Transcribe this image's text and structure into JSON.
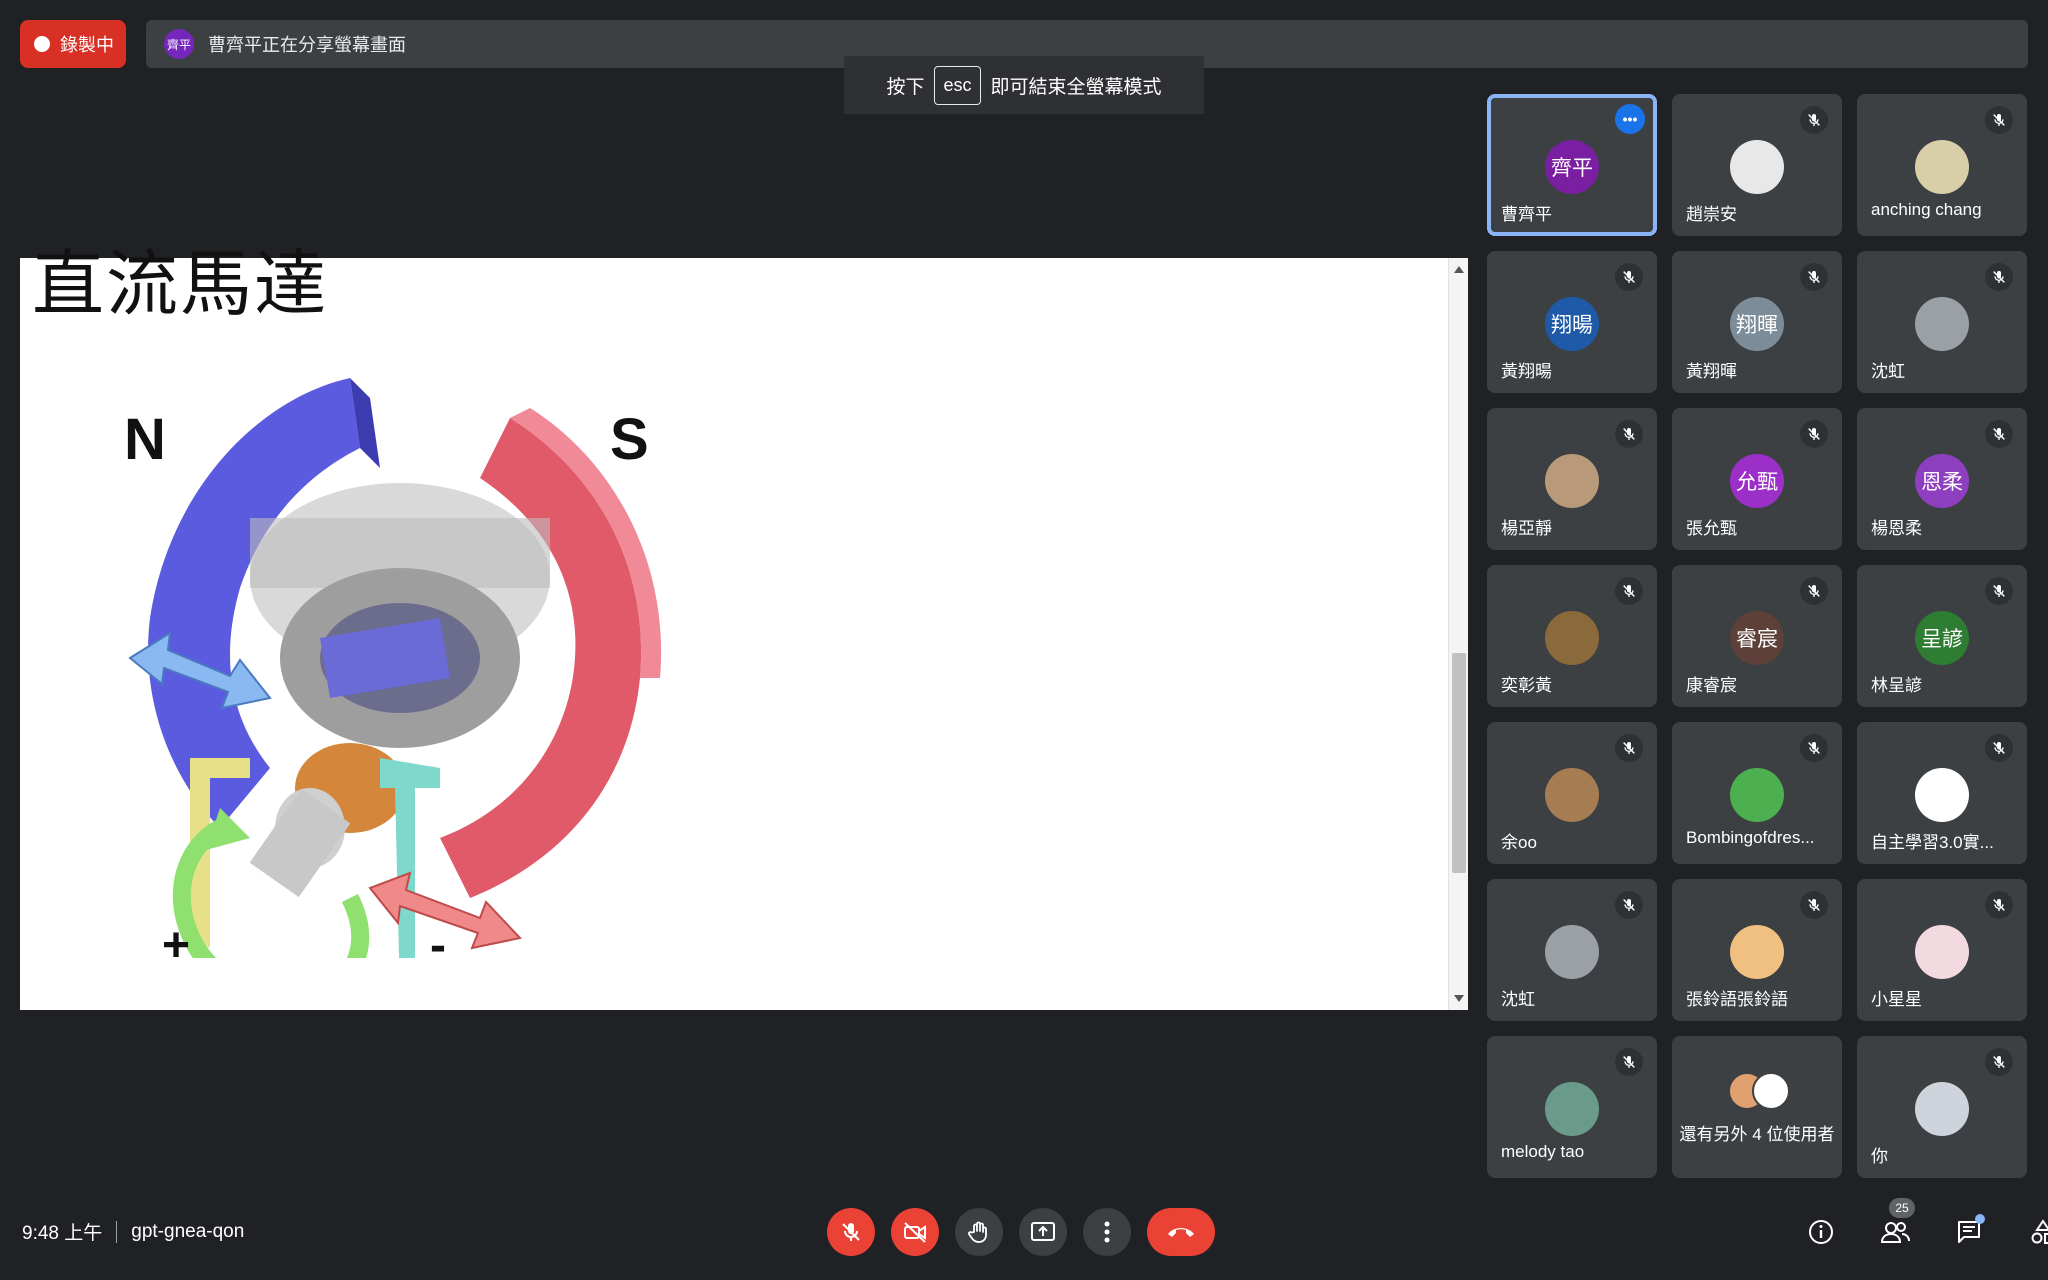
{
  "recording": {
    "label": "錄製中"
  },
  "share_banner": {
    "avatar_text": "齊平",
    "text": "曹齊平正在分享螢幕畫面"
  },
  "esc_hint": {
    "prefix": "按下",
    "key": "esc",
    "suffix": "即可結束全螢幕模式"
  },
  "slide": {
    "title": "直流馬達",
    "pole_n": "N",
    "pole_s": "S",
    "terminal_plus": "+",
    "terminal_minus": "-"
  },
  "participants": [
    {
      "name": "曹齊平",
      "avatar_text": "齊平",
      "avatar_color": "#7b1fa2",
      "active": true
    },
    {
      "name": "趙崇安",
      "avatar_text": "",
      "avatar_color": "#e8e8e8"
    },
    {
      "name": "anching chang",
      "avatar_text": "",
      "avatar_color": "#d8cfa8"
    },
    {
      "name": "黃翔暘",
      "avatar_text": "翔暘",
      "avatar_color": "#1e5aa8"
    },
    {
      "name": "黃翔暉",
      "avatar_text": "翔暉",
      "avatar_color": "#7c8c99"
    },
    {
      "name": "沈虹",
      "avatar_text": "",
      "avatar_color": "#9aa0a6"
    },
    {
      "name": "楊亞靜",
      "avatar_text": "",
      "avatar_color": "#b89a7a"
    },
    {
      "name": "張允甄",
      "avatar_text": "允甄",
      "avatar_color": "#9c2fc7"
    },
    {
      "name": "楊恩柔",
      "avatar_text": "恩柔",
      "avatar_color": "#8e3fbf"
    },
    {
      "name": "奕彰黃",
      "avatar_text": "",
      "avatar_color": "#8a6a3a"
    },
    {
      "name": "康睿宸",
      "avatar_text": "睿宸",
      "avatar_color": "#5d4037"
    },
    {
      "name": "林呈諺",
      "avatar_text": "呈諺",
      "avatar_color": "#2e7d32"
    },
    {
      "name": "余oo",
      "avatar_text": "",
      "avatar_color": "#a67c52"
    },
    {
      "name": "Bombingofdres...",
      "avatar_text": "",
      "avatar_color": "#4caf50"
    },
    {
      "name": "自主學習3.0實...",
      "avatar_text": "",
      "avatar_color": "#ffffff"
    },
    {
      "name": "沈虹",
      "avatar_text": "",
      "avatar_color": "#9aa0a6"
    },
    {
      "name": "張鈴語張鈴語",
      "avatar_text": "",
      "avatar_color": "#f0c080"
    },
    {
      "name": "小星星",
      "avatar_text": "",
      "avatar_color": "#f3d9e0"
    },
    {
      "name": "melody tao",
      "avatar_text": "",
      "avatar_color": "#6a9a8a"
    },
    {
      "name": "還有另外 4 位使用者",
      "avatar_text": "",
      "avatar_color": "",
      "others": true
    },
    {
      "name": "你",
      "avatar_text": "",
      "avatar_color": "#cfd4dc"
    }
  ],
  "bottom": {
    "time": "9:48 上午",
    "meeting_code": "gpt-gnea-qon",
    "participant_count": "25"
  },
  "colors": {
    "accent": "#8ab4f8",
    "danger": "#ea4335",
    "tile_bg": "#3c4043",
    "page_bg": "#202124"
  }
}
